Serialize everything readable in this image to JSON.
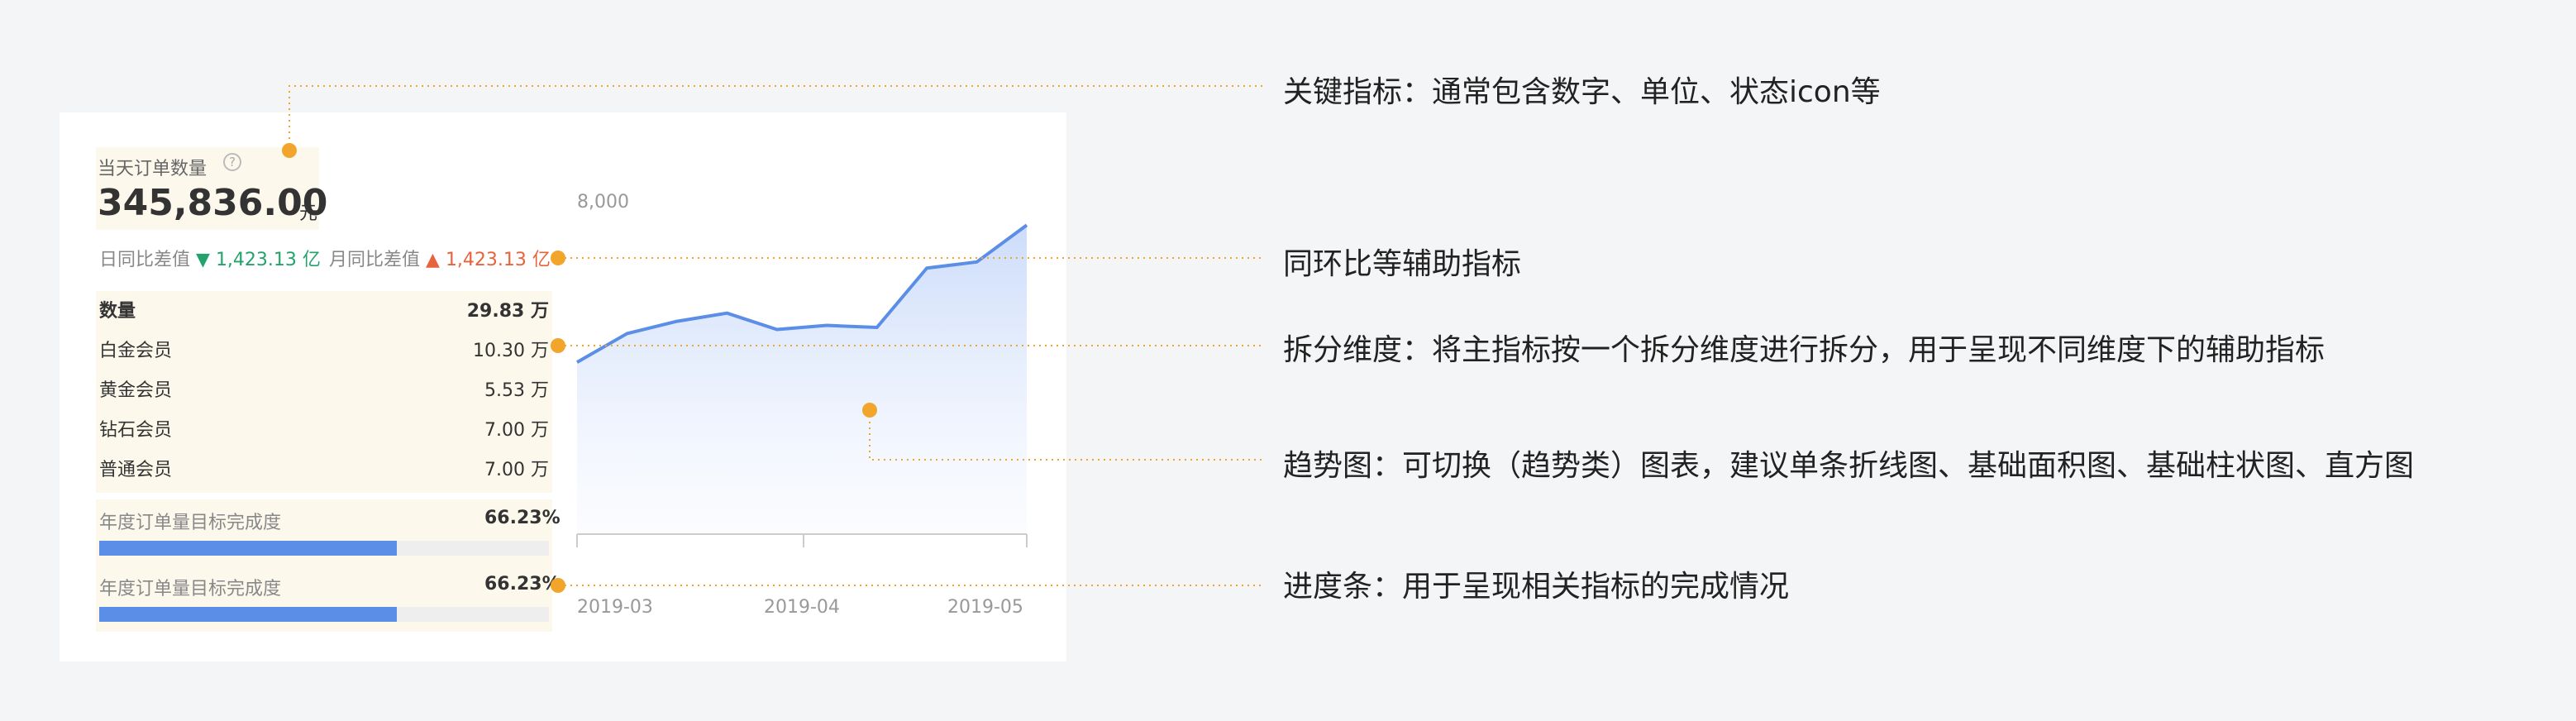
{
  "metric": {
    "title": "当天订单数量",
    "help_icon": "?",
    "value": "345,836.00",
    "unit": "元"
  },
  "aux": {
    "day_label": "日同比差值",
    "day_arrow": "▼",
    "day_value": "1,423.13 亿",
    "month_label": "月同比差值",
    "month_arrow": "▲",
    "month_value": "1,423.13 亿"
  },
  "breakdown": {
    "header": {
      "name": "数量",
      "value": "29.83 万"
    },
    "rows": [
      {
        "name": "白金会员",
        "value": "10.30 万"
      },
      {
        "name": "黄金会员",
        "value": "5.53 万"
      },
      {
        "name": "钻石会员",
        "value": "7.00 万"
      },
      {
        "name": "普通会员",
        "value": "7.00 万"
      }
    ]
  },
  "progress": [
    {
      "label": "年度订单量目标完成度",
      "percent": "66.23%",
      "value": 0.6623
    },
    {
      "label": "年度订单量目标完成度",
      "percent": "66.23%",
      "value": 0.6623
    }
  ],
  "chart_data": {
    "type": "area",
    "y_tick": "8,000",
    "ylim": [
      0,
      8000
    ],
    "x_ticks": [
      "2019-03",
      "2019-04",
      "2019-05"
    ],
    "values": [
      4200,
      4900,
      5200,
      5400,
      5000,
      5100,
      5050,
      6500,
      6650,
      7550
    ],
    "color": "#5b8ee6"
  },
  "annotations": [
    "关键指标：通常包含数字、单位、状态icon等",
    "同环比等辅助指标",
    "拆分维度：将主指标按一个拆分维度进行拆分，用于呈现不同维度下的辅助指标",
    "趋势图：可切换（趋势类）图表，建议单条折线图、基础面积图、基础柱状图、直方图",
    "进度条：用于呈现相关指标的完成情况"
  ],
  "colors": {
    "accent": "#5b8ee6",
    "marker": "#f2a52b",
    "up": "#e8623b",
    "down": "#23a36b"
  }
}
